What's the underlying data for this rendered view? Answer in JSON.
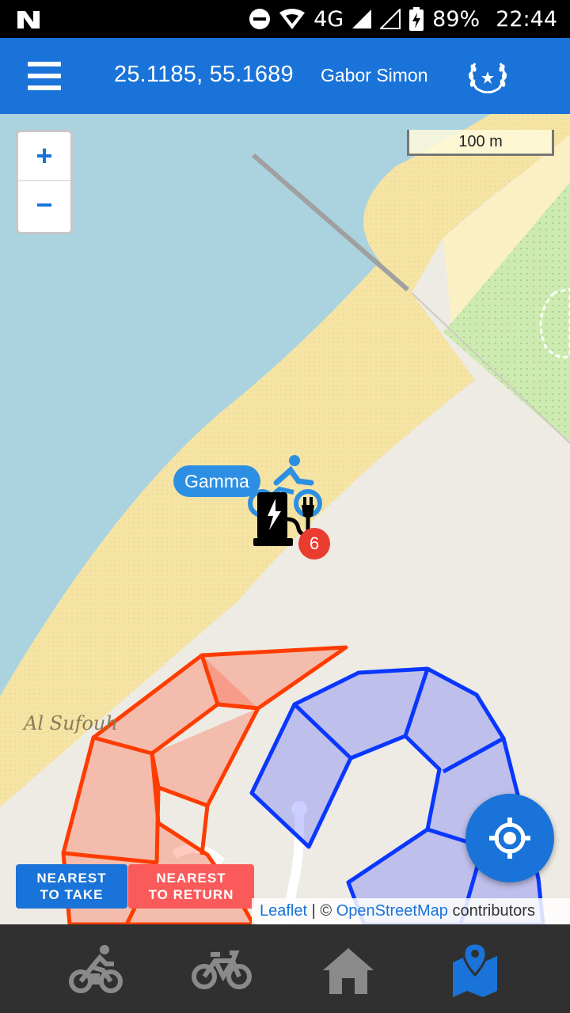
{
  "statusbar": {
    "network": "4G",
    "battery": "89%",
    "time": "22:44"
  },
  "appbar": {
    "coordinates": "25.1185, 55.1689",
    "user_name": "Gabor Simon",
    "badge_icon": "laurel-star-icon",
    "menu_icon": "hamburger-menu-icon"
  },
  "map": {
    "zoom_in": "+",
    "zoom_out": "−",
    "scale_label": "100 m",
    "place_label": "Al Sufouh",
    "station": {
      "name": "Gamma",
      "count": "6",
      "icons": [
        "ebike-icon",
        "charging-station-icon"
      ]
    },
    "attribution": {
      "leaflet": "Leaflet",
      "separator": "| ©",
      "osm": "OpenStreetMap",
      "suffix": "contributors"
    },
    "colors": {
      "water": "#aad3df",
      "sand": "#f5e4a4",
      "park": "#cdebb0",
      "land": "#eeeae4",
      "return_zone": "#ff3c00",
      "take_zone": "#0a37ff"
    }
  },
  "actions": {
    "nearest_take": "NEAREST\nTO TAKE",
    "nearest_return": "NEAREST\nTO RETURN"
  },
  "bottomnav": {
    "items": [
      {
        "icon": "ebike-icon",
        "active": false
      },
      {
        "icon": "bicycle-icon",
        "active": false
      },
      {
        "icon": "home-icon",
        "active": false
      },
      {
        "icon": "map-marker-icon",
        "active": true
      }
    ],
    "active_color": "#1a73d8",
    "inactive_color": "#8a8a8a"
  }
}
